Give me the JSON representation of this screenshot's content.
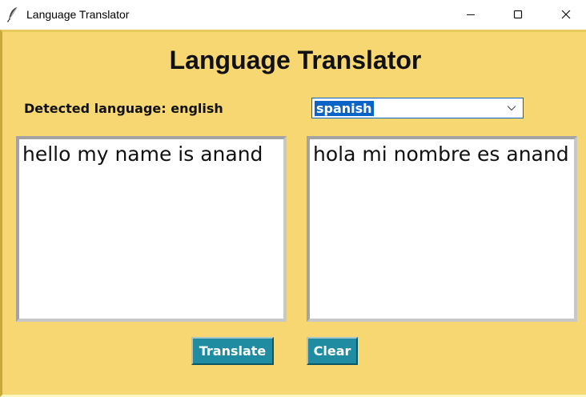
{
  "window": {
    "title": "Language Translator",
    "icon": "feather-icon"
  },
  "app": {
    "heading": "Language Translator",
    "detected_label": "Detected language: english",
    "target_language": {
      "selected": "spanish"
    },
    "source_text": "hello my name is anand",
    "translated_text": "hola mi nombre es anand",
    "translate_label": "Translate",
    "clear_label": "Clear"
  },
  "colors": {
    "background": "#f6d772",
    "button": "#1f8ca2",
    "selection": "#0a64c8"
  }
}
